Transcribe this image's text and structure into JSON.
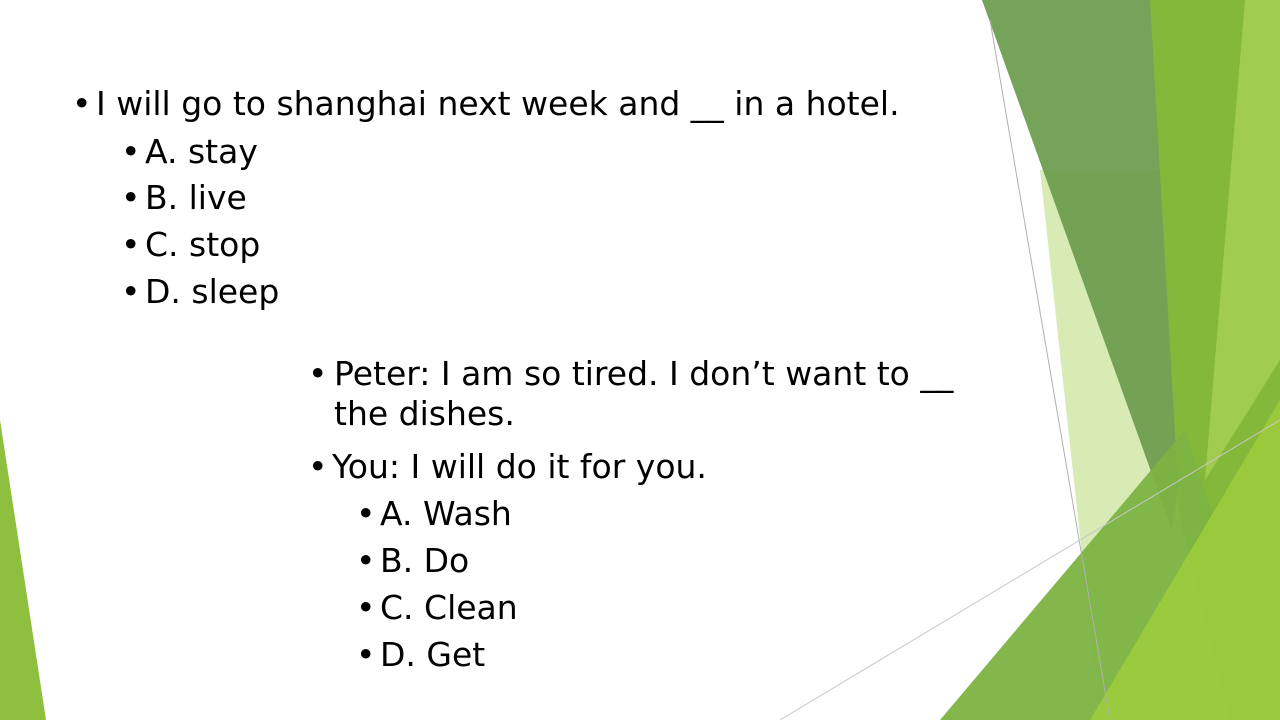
{
  "question1": {
    "prompt": "I will go to shanghai next week and __ in a hotel.",
    "options": [
      "A. stay",
      "B. live",
      "C. stop",
      "D. sleep"
    ]
  },
  "question2": {
    "dialogue": [
      "Peter: I am so tired. I don’t want to __ the dishes.",
      "You: I will do it for you."
    ],
    "options": [
      "A. Wash",
      "B. Do",
      "C. Clean",
      "D. Get"
    ]
  },
  "theme": {
    "green_dark": "#6e9e50",
    "green_mid": "#84b83a",
    "green_light": "#a3cf52",
    "green_pale": "#d2e8a8"
  }
}
